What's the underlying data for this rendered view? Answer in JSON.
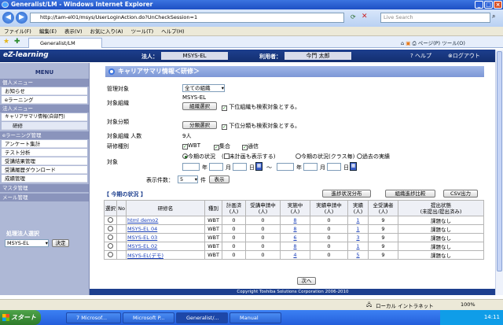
{
  "window": {
    "title": "Generalist/LM - Windows Internet Explorer"
  },
  "browser": {
    "url": "http://tam-el01/msys/UserLoginAction.do?UnCheckSession=1",
    "search_placeholder": "Live Search",
    "menu": [
      "ファイル(F)",
      "編集(E)",
      "表示(V)",
      "お気に入り(A)",
      "ツール(T)",
      "ヘルプ(H)"
    ],
    "tab_label": "Generalist/LM",
    "cmd_page": "ページ(P)",
    "cmd_tools": "ツール(O)"
  },
  "app": {
    "logo": "eZ-learning",
    "corp_label": "法人：",
    "corp_value": "MSYS-EL",
    "user_label": "利用者：",
    "user_value": "今門 太郎",
    "help": "ヘルプ",
    "logout": "ログアウト"
  },
  "sidebar": {
    "title": "MENU",
    "sections": [
      {
        "label": "個人メニュー"
      },
      {
        "label": "お知らせ"
      },
      {
        "label": "eラーニング"
      },
      {
        "label": "法人メニュー"
      },
      {
        "label": "キャリアサマリ情報(自部門)"
      },
      {
        "label": "研修"
      },
      {
        "label": "eラーニング管理"
      },
      {
        "label": "アンケート集計"
      },
      {
        "label": "テスト分析"
      },
      {
        "label": "受講結果管理"
      },
      {
        "label": "受講履歴ダウンロード"
      },
      {
        "label": "成績管理"
      },
      {
        "label": "マスタ管理"
      },
      {
        "label": "メール管理"
      }
    ],
    "corp_select_label": "処理法人選択",
    "corp_select_value": "MSYS-EL",
    "decide": "決定"
  },
  "main": {
    "title": "キャリアサマリ情報＜研修＞",
    "target_label": "管理対象",
    "target_value": "全ての組織",
    "org_label": "対象組織",
    "org_value": "MSYS-EL",
    "org_btn": "組織選択",
    "org_chk": "下位組織も検索対象とする。",
    "cls_label": "対象分類",
    "cls_btn": "分類選択",
    "cls_chk": "下位分類も検索対象とする。",
    "people_label": "対象組織 人数",
    "people_value": "9人",
    "type_label": "研修種別",
    "type_opts": [
      "WBT",
      "集合",
      "通信"
    ],
    "target2_label": "対象",
    "radio_opts": [
      "今期の状況",
      "未計画も表示する",
      "今期の状況(クラス毎)",
      "過去の実績"
    ],
    "year": "年",
    "month": "月",
    "day": "日",
    "tilde": "～",
    "count_label": "表示件数：",
    "count_value": "5",
    "count_unit": "件",
    "show_btn": "表示",
    "section_title": "【 今期の状況 】",
    "btn_dist": "進捗状況分布",
    "btn_cmp": "組織進捗比較",
    "btn_csv": "CSV出力",
    "headers": [
      "選択",
      "No",
      "研修名",
      "種別",
      "計画済\n(人)",
      "受講申請中\n(人)",
      "実施中\n(人)",
      "実績申請中\n(人)",
      "実績\n(人)",
      "全受講者\n(人)",
      "提出状態\n(未提出/提出済み)"
    ],
    "rows": [
      {
        "no": "",
        "name": "html demo2",
        "type": "WBT",
        "plan": "0",
        "apply": "0",
        "doing": "8",
        "rapply": "0",
        "done": "1",
        "total": "9",
        "status": "課題なし"
      },
      {
        "no": "",
        "name": "MSYS-EL 04",
        "type": "WBT",
        "plan": "0",
        "apply": "0",
        "doing": "8",
        "rapply": "0",
        "done": "1",
        "total": "9",
        "status": "課題なし"
      },
      {
        "no": "",
        "name": "MSYS-EL 03",
        "type": "WBT",
        "plan": "0",
        "apply": "0",
        "doing": "6",
        "rapply": "0",
        "done": "3",
        "total": "9",
        "status": "課題なし"
      },
      {
        "no": "",
        "name": "MSYS-EL 02",
        "type": "WBT",
        "plan": "0",
        "apply": "0",
        "doing": "8",
        "rapply": "0",
        "done": "1",
        "total": "9",
        "status": "課題なし"
      },
      {
        "no": "",
        "name": "MSYS-EL(デモ)",
        "type": "WBT",
        "plan": "0",
        "apply": "0",
        "doing": "4",
        "rapply": "0",
        "done": "5",
        "total": "9",
        "status": "課題なし"
      }
    ],
    "next_btn": "次へ",
    "copyright": "Copyright Toshiba Solutions Corporation 2006-2010"
  },
  "status": {
    "zone": "ローカル イントラネット",
    "zoom": "100%"
  },
  "taskbar": {
    "start": "スタート",
    "tasks": [
      "7 Microsof...",
      "Microsoft P...",
      "Generalist/...",
      "Manual"
    ],
    "clock": "14:11"
  }
}
